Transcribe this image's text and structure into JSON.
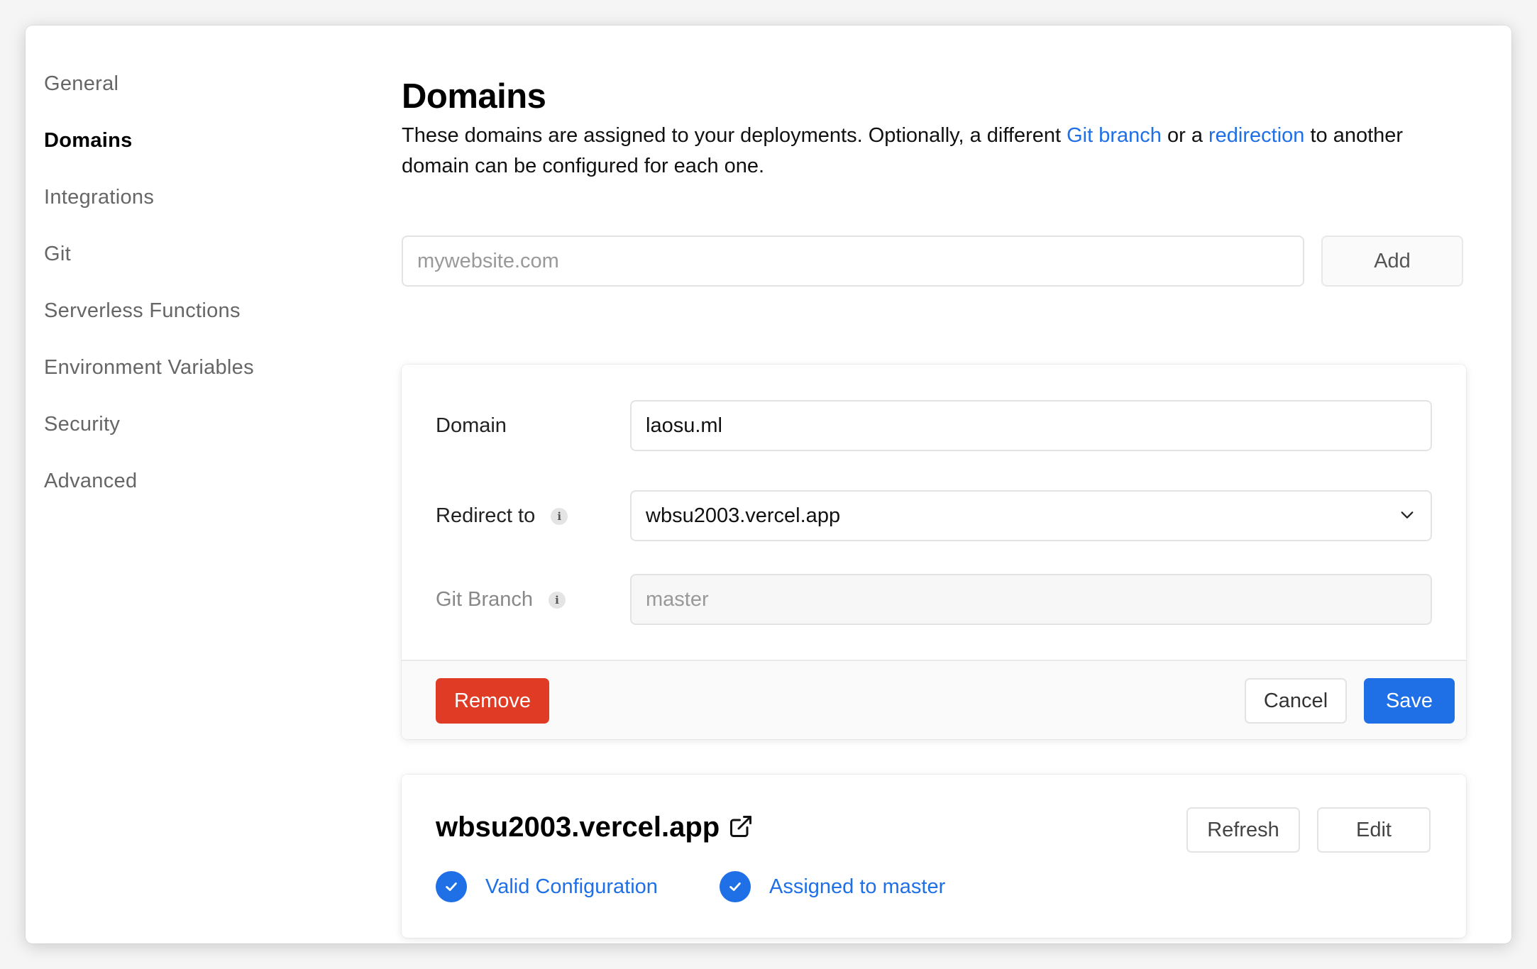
{
  "sidebar": {
    "items": [
      {
        "label": "General",
        "active": false
      },
      {
        "label": "Domains",
        "active": true
      },
      {
        "label": "Integrations",
        "active": false
      },
      {
        "label": "Git",
        "active": false
      },
      {
        "label": "Serverless Functions",
        "active": false
      },
      {
        "label": "Environment Variables",
        "active": false
      },
      {
        "label": "Security",
        "active": false
      },
      {
        "label": "Advanced",
        "active": false
      }
    ]
  },
  "main": {
    "title": "Domains",
    "description": {
      "part1": "These domains are assigned to your deployments. Optionally, a different ",
      "link1": "Git branch",
      "part2": " or a ",
      "link2": "redirection",
      "part3": " to another domain can be configured for each one."
    },
    "add_domain": {
      "placeholder": "mywebsite.com",
      "value": "",
      "button_label": "Add"
    }
  },
  "edit_card": {
    "domain_label": "Domain",
    "domain_value": "laosu.ml",
    "redirect_label": "Redirect to",
    "redirect_value": "wbsu2003.vercel.app",
    "git_branch_label": "Git Branch",
    "git_branch_value": "master",
    "remove_label": "Remove",
    "cancel_label": "Cancel",
    "save_label": "Save",
    "info_glyph": "i"
  },
  "domain_card": {
    "name": "wbsu2003.vercel.app",
    "refresh_label": "Refresh",
    "edit_label": "Edit",
    "status1": "Valid Configuration",
    "status2": "Assigned to master"
  },
  "colors": {
    "accent": "#1f6fe6",
    "danger": "#e03b24"
  },
  "icons": [
    "info-icon",
    "chevron-down-icon",
    "external-link-icon",
    "check-circle-icon"
  ]
}
